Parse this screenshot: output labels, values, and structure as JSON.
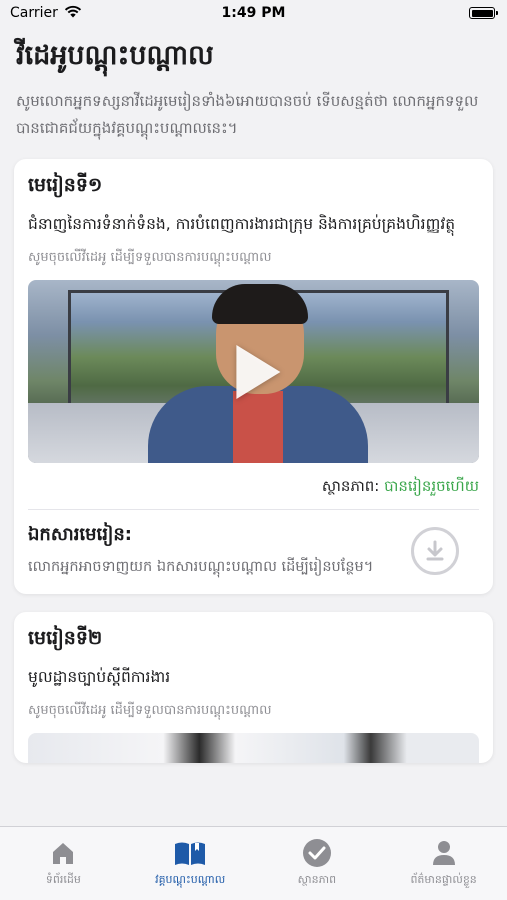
{
  "status_bar": {
    "carrier": "Carrier",
    "time": "1:49 PM"
  },
  "page": {
    "title": "វីដេអូបណ្តុះបណ្តាល",
    "description": "សូមលោកអ្នកទស្សនាវីដេអូមេរៀនទាំង៦អោយបានចប់ ទើបសន្មត់ថា លោកអ្នកទទួលបានជោគជ័យក្នុងវគ្គបណ្តុះបណ្តាលនេះ។"
  },
  "lessons": [
    {
      "number": "មេរៀនទី១",
      "topic": "ជំនាញនៃការទំនាក់ទំនង, ការបំពេញការងារជាក្រុម និងការគ្រប់គ្រងហិរញ្ញវត្ថុ",
      "hint": "សូមចុចលើវីដេអូ ដើម្បីទទួលបានការបណ្តុះបណ្តាល",
      "status_label": "ស្ថានភាព:",
      "status_value": "បានរៀនរួចហើយ",
      "doc_title": "ឯកសារមេរៀន:",
      "doc_desc": "លោកអ្នកអាចទាញយក ឯកសារបណ្តុះបណ្តាល ដើម្បីរៀនបន្ថែម។"
    },
    {
      "number": "មេរៀនទី២",
      "topic": "មូលដ្ឋានច្បាប់ស្តីពីការងារ",
      "hint": "សូមចុចលើវីដេអូ ដើម្បីទទួលបានការបណ្តុះបណ្តាល"
    }
  ],
  "tabs": [
    {
      "label": "ទំព័រដើម",
      "icon": "home-icon"
    },
    {
      "label": "វគ្គបណ្តុះបណ្តាល",
      "icon": "book-icon",
      "active": true
    },
    {
      "label": "ស្ថានភាព",
      "icon": "check-circle-icon"
    },
    {
      "label": "ព័ត៌មានផ្ទាល់ខ្លួន",
      "icon": "person-icon"
    }
  ],
  "colors": {
    "accent": "#1e5aa8",
    "status_done": "#3aa64b"
  }
}
